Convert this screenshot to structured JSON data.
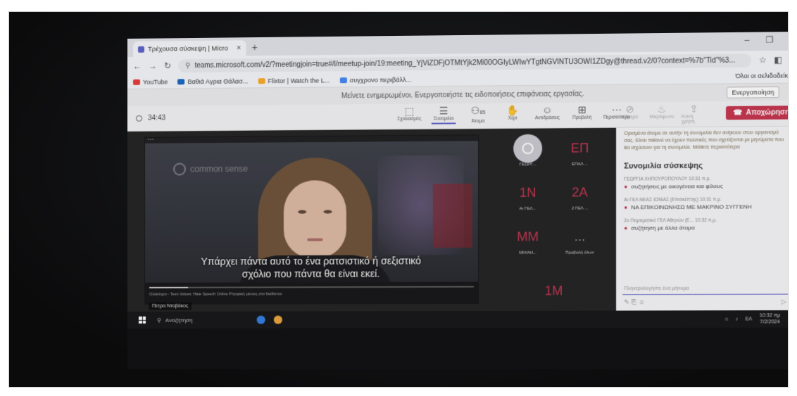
{
  "browser": {
    "tab_title": "Τρέχουσα σύσκεψη | Micro",
    "new_tab": "+",
    "url": "teams.microsoft.com/v2/?meetingjoin=true#/l/meetup-join/19:meeting_YjViZDFjOTMtYjk2Mi00OGIyLWIwYTgtNGVlNTU3OWI1ZDgy@thread.v2/0?context=%7b\"Tid\"%3...",
    "bookmarks": [
      {
        "label": "YouTube",
        "color": "#e53935"
      },
      {
        "label": "Βαθιά Αγρια Θάλασ...",
        "color": "#1565c0"
      },
      {
        "label": "Flixtor | Watch the L...",
        "color": "#f9a825"
      },
      {
        "label": "συγχρονο περιβάλλ...",
        "color": "#4285f4"
      }
    ],
    "all_bookmarks": "Όλοι οι σελιδοδείκτες"
  },
  "notification": {
    "text": "Μείνετε ενημερωμένοι. Ενεργοποιήστε τις ειδοποιήσεις επιφάνειας εργασίας.",
    "button": "Ενεργοποίηση"
  },
  "meeting": {
    "timer": "34:43",
    "tools": [
      {
        "label": "Σχολιασμός",
        "icon": "screen-icon"
      },
      {
        "label": "Συνομιλία",
        "icon": "chat-icon"
      },
      {
        "label": "Άτομα",
        "icon": "people-icon",
        "count": "85"
      },
      {
        "label": "Χέρι",
        "icon": "hand-icon"
      },
      {
        "label": "Αντιδράσεις",
        "icon": "emoji-icon"
      },
      {
        "label": "Προβολή",
        "icon": "view-icon"
      },
      {
        "label": "Περισσότερα",
        "icon": "more-icon"
      }
    ],
    "disabled_tools": [
      "Κάμερα",
      "Μικρόφωνο",
      "Κοινή χρήση"
    ],
    "leave_button": "Αποχώρηση"
  },
  "video": {
    "brand": "common sense",
    "caption_line1": "Υπάρχει πάντα αυτό το ένα ρατσιστικό ή σεξιστικό",
    "caption_line2": "σχόλιο που πάντα θα είναι εκεί.",
    "player_title": "Ολόκληρο - Teen Voices: Hate Speech Online Ρητορική μίσους στο διαδίκτυο",
    "progress": 0.12,
    "presenter": "Πετρα Ντοβάκος"
  },
  "participants": [
    {
      "initials": "",
      "name": "ΓΕΩΡΓ..."
    },
    {
      "initials": "ΕΠ",
      "name": "ΕΠΑΛ ..."
    },
    {
      "initials": "1N",
      "name": "Αι ΓΕΛ..."
    },
    {
      "initials": "2A",
      "name": "2 ΓΕΛ ..."
    },
    {
      "initials": "MM",
      "name": "ΜΙΧΑΗ..."
    },
    {
      "initials": "...",
      "name": "Προβολή όλων"
    },
    {
      "initials": "1M",
      "name": ""
    }
  ],
  "chat": {
    "warning": "Ορισμένα άτομα σε αυτήν τη συνομιλία δεν ανήκουν στον οργανισμό σας. Είναι πιθανό να έχουν πολιτικές που σχετίζονται με μηνύματα που θα ισχύσουν για τη συνομιλία. Μάθετε περισσότερα",
    "title": "Συνομιλία σύσκεψης",
    "messages": [
      {
        "author": "ΓΕΩΡΓΙΑ ΧΗΠΟΥΡΟΠΟΥΛΟΥ 10:31 π.μ.",
        "text": "συζητήσεις με οικογένεια και φίλους"
      },
      {
        "author": "Αι ΓΕΛ ΝΕΑΣ ΙΩΝΙΑΣ (Επισκέπτης) 10:31 π.μ.",
        "text": "ΝΑ ΕΠΙΚΟΙΝΩΝΗΣΩ ΜΕ ΜΑΚΡΙΝΟ ΣΥΓΓΕΝΗ"
      },
      {
        "author": "2ο Πειραματικό ΓΕΛ Αθηνών (Ε... 10:32 π.μ.",
        "text": "συζήτηση με άλλα άτομα"
      }
    ],
    "compose_placeholder": "Πληκτρολογήστε ένα μήνυμα"
  },
  "taskbar": {
    "search": "Αναζήτηση",
    "lang": "ΕΛ",
    "time": "10:32 πμ",
    "date": "7/2/2024"
  }
}
